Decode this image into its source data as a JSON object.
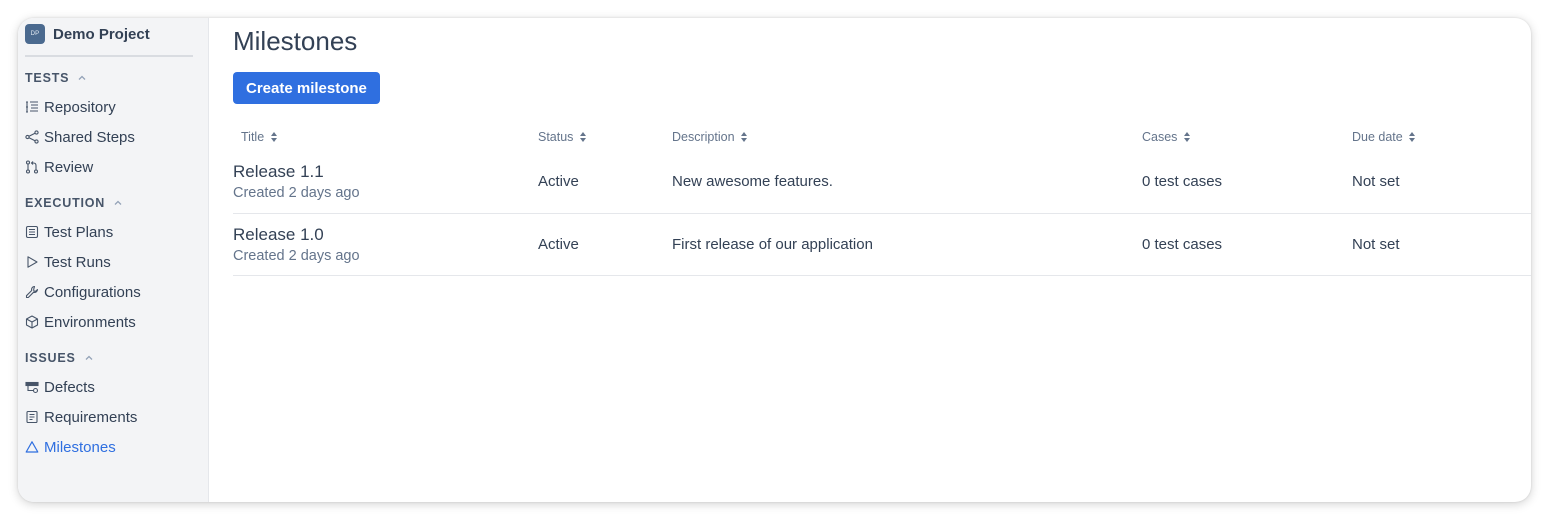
{
  "project": {
    "badge": "DP",
    "name": "Demo Project"
  },
  "sidebar": {
    "sections": [
      {
        "title": "TESTS",
        "items": [
          {
            "label": "Repository",
            "icon": "repository-icon"
          },
          {
            "label": "Shared Steps",
            "icon": "share-icon"
          },
          {
            "label": "Review",
            "icon": "pull-request-icon"
          }
        ]
      },
      {
        "title": "EXECUTION",
        "items": [
          {
            "label": "Test Plans",
            "icon": "test-plan-icon"
          },
          {
            "label": "Test Runs",
            "icon": "play-icon"
          },
          {
            "label": "Configurations",
            "icon": "wrench-icon"
          },
          {
            "label": "Environments",
            "icon": "cube-icon"
          }
        ]
      },
      {
        "title": "ISSUES",
        "items": [
          {
            "label": "Defects",
            "icon": "defect-icon"
          },
          {
            "label": "Requirements",
            "icon": "document-icon"
          },
          {
            "label": "Milestones",
            "icon": "milestone-icon",
            "active": true
          }
        ]
      }
    ]
  },
  "main": {
    "title": "Milestones",
    "create_button": "Create milestone",
    "columns": [
      "Title",
      "Status",
      "Description",
      "Cases",
      "Due date"
    ],
    "rows": [
      {
        "title": "Release 1.1",
        "created": "Created 2 days ago",
        "status": "Active",
        "description": "New awesome features.",
        "cases": "0 test cases",
        "due": "Not set"
      },
      {
        "title": "Release 1.0",
        "created": "Created 2 days ago",
        "status": "Active",
        "description": "First release of our application",
        "cases": "0 test cases",
        "due": "Not set"
      }
    ]
  },
  "colors": {
    "accent": "#2f6fe0",
    "sidebar_bg": "#f3f4f6",
    "text": "#334155",
    "muted": "#64748b"
  }
}
